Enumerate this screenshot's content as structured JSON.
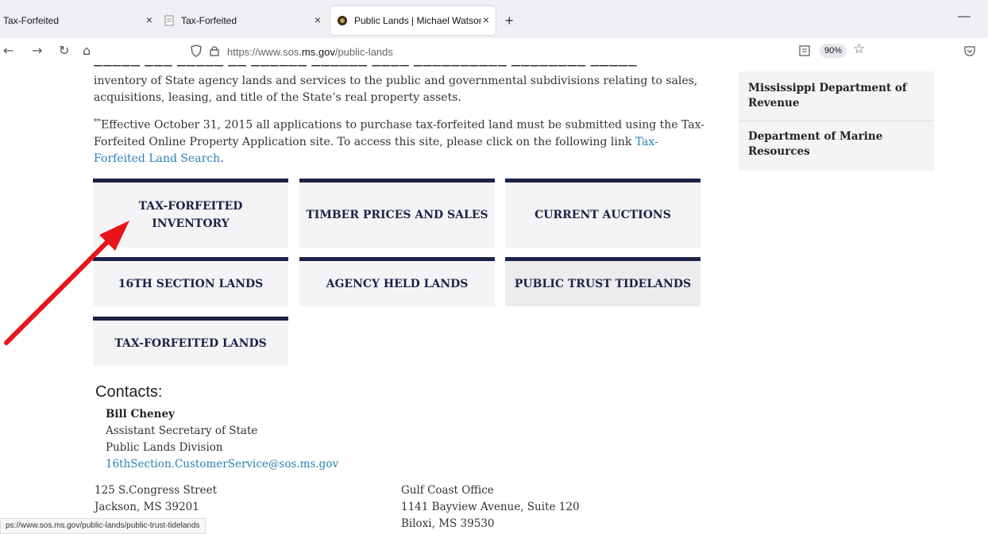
{
  "browser": {
    "tabs": [
      {
        "title": "Tax-Forfeited",
        "active": false
      },
      {
        "title": "Tax-Forfeited",
        "active": false
      },
      {
        "title": "Public Lands | Michael Watson S",
        "active": true
      }
    ],
    "new_tab": "+",
    "close_glyph": "×",
    "url_prefix": "https://www.sos.",
    "url_host": "ms.gov",
    "url_path": "/public-lands",
    "zoom": "90%",
    "status_url": "ps://www.sos.ms.gov/public-lands/public-trust-tidelands"
  },
  "content": {
    "para1": "inventory of State agency lands and services to the public and governmental subdivisions relating to sales, acquisitions, leasing, and title of the State’s real property assets.",
    "para2_marker": "**",
    "para2_text": "Effective October 31, 2015 all applications to purchase tax-forfeited land must be submitted using the Tax-Forfeited Online Property Application site. To access this site, please click on the following link ",
    "para2_link": "Tax-Forfeited Land Search",
    "para2_end": "."
  },
  "sidebar": {
    "items": [
      "Mississippi Department of Revenue",
      "Department of Marine Resources"
    ]
  },
  "tiles": [
    "TAX-FORFEITED INVENTORY",
    "TIMBER PRICES AND SALES",
    "CURRENT AUCTIONS",
    "16TH SECTION LANDS",
    "AGENCY HELD LANDS",
    "PUBLIC TRUST TIDELANDS",
    "TAX-FORFEITED LANDS"
  ],
  "contacts": {
    "heading": "Contacts:",
    "name": "Bill Cheney",
    "title": "Assistant Secretary of State",
    "division": "Public Lands Division",
    "email": "16thSection.CustomerService@sos.ms.gov",
    "jackson": {
      "street": "125 S.Congress Street",
      "city": "Jackson, MS 39201"
    },
    "gulf": {
      "name": "Gulf Coast Office",
      "street": "1141 Bayview Avenue, Suite 120",
      "city": "Biloxi, MS 39530"
    }
  },
  "colors": {
    "tile_border": "#1c2346",
    "link": "#2a7fb8",
    "arrow": "#e8141b"
  }
}
